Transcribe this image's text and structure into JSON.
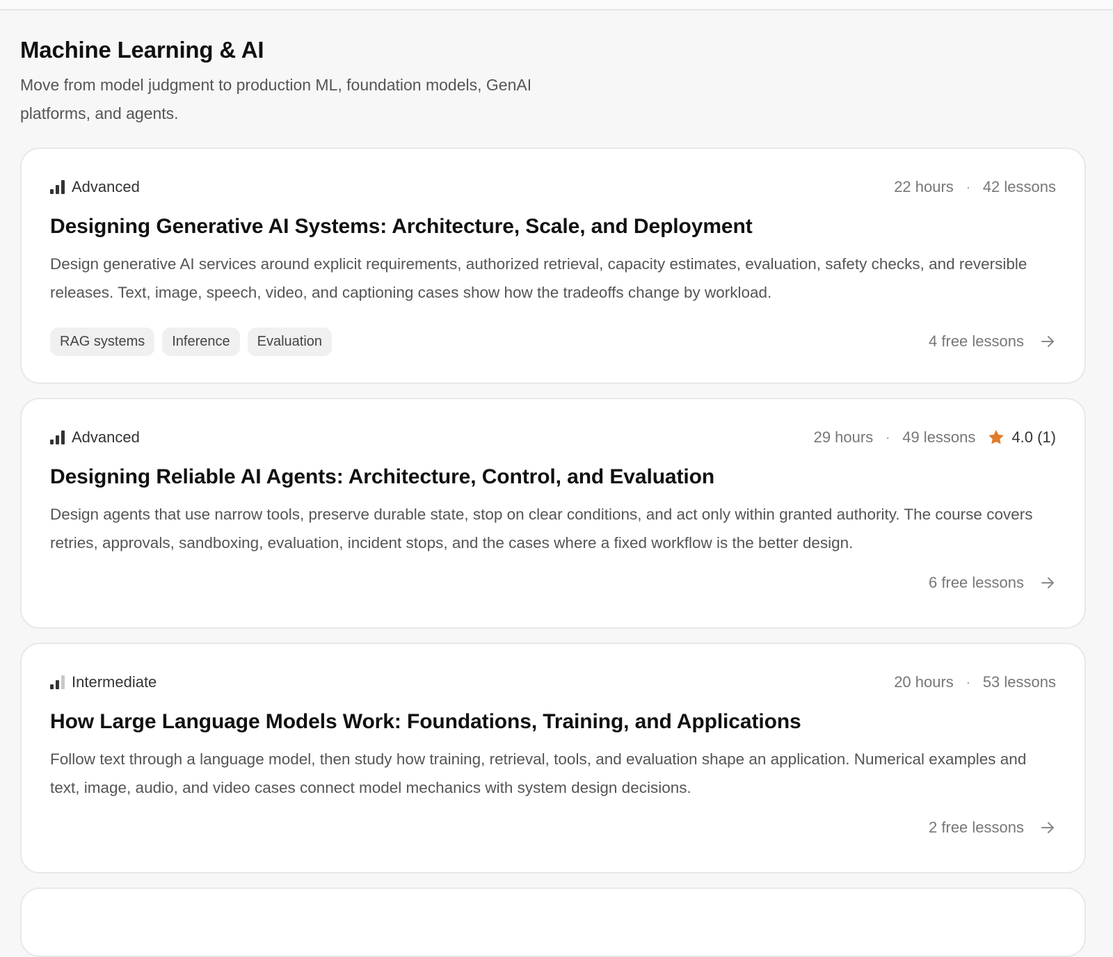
{
  "section": {
    "title": "Machine Learning & AI",
    "subtitle": "Move from model judgment to production ML, foundation models, GenAI platforms, and agents."
  },
  "courses": [
    {
      "level": "Advanced",
      "level_bars_filled": 3,
      "hours": "22 hours",
      "lessons": "42 lessons",
      "title": "Designing Generative AI Systems: Architecture, Scale, and Deployment",
      "description": "Design generative AI services around explicit requirements, authorized retrieval, capacity estimates, evaluation, safety checks, and reversible releases. Text, image, speech, video, and captioning cases show how the tradeoffs change by workload.",
      "tags": [
        "RAG systems",
        "Inference",
        "Evaluation"
      ],
      "free_lessons": "4 free lessons"
    },
    {
      "level": "Advanced",
      "level_bars_filled": 3,
      "hours": "29 hours",
      "lessons": "49 lessons",
      "rating": "4.0 (1)",
      "title": "Designing Reliable AI Agents: Architecture, Control, and Evaluation",
      "description": "Design agents that use narrow tools, preserve durable state, stop on clear conditions, and act only within granted authority. The course covers retries, approvals, sandboxing, evaluation, incident stops, and the cases where a fixed workflow is the better design.",
      "free_lessons": "6 free lessons"
    },
    {
      "level": "Intermediate",
      "level_bars_filled": 2,
      "hours": "20 hours",
      "lessons": "53 lessons",
      "title": "How Large Language Models Work: Foundations, Training, and Applications",
      "description": "Follow text through a language model, then study how training, retrieval, tools, and evaluation shape an application. Numerical examples and text, image, audio, and video cases connect model mechanics with system design decisions.",
      "free_lessons": "2 free lessons"
    }
  ],
  "colors": {
    "star": "#E07B2A",
    "text_primary": "#111111",
    "text_secondary": "#555555",
    "text_muted": "#777777"
  },
  "icons": {
    "level": "signal-bars-icon",
    "rating": "star-icon",
    "link": "arrow-right-icon"
  }
}
